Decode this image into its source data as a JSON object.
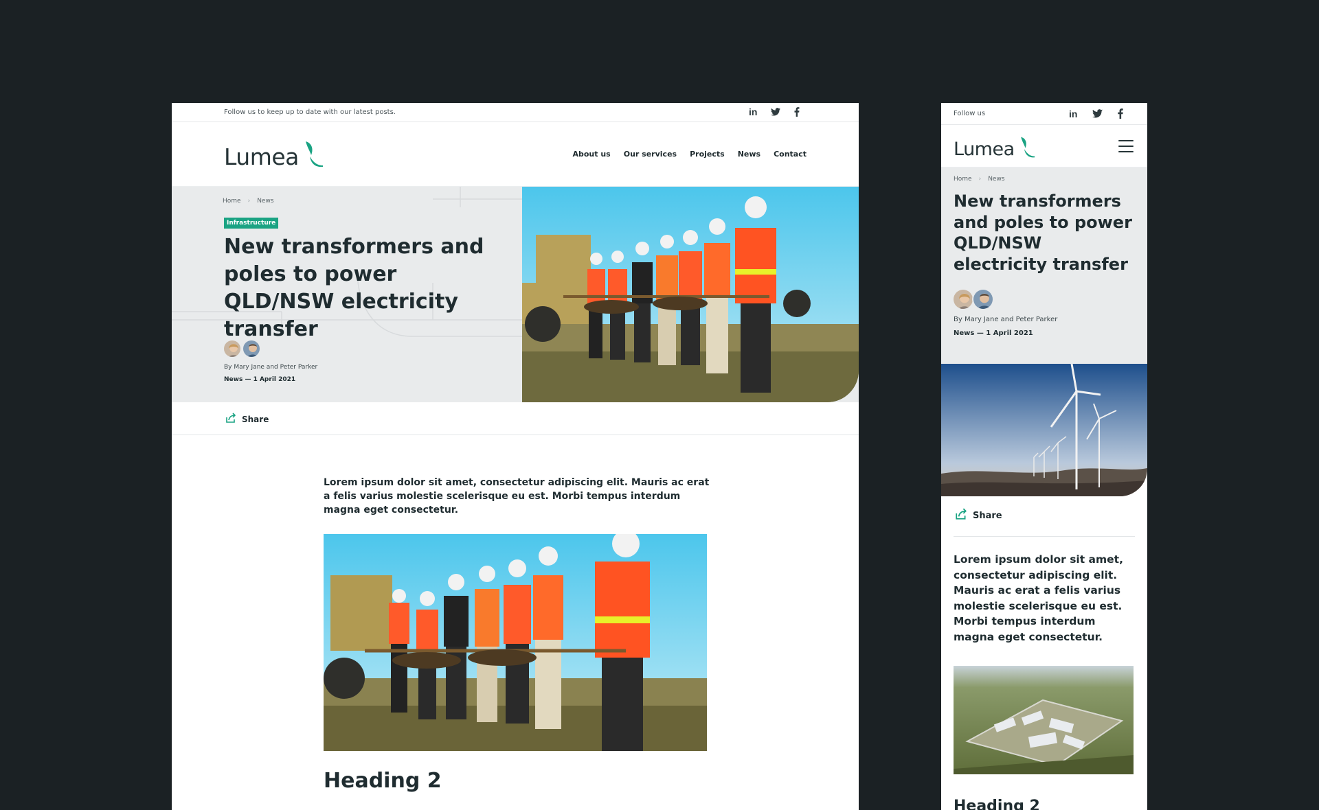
{
  "desktop": {
    "topbar": {
      "follow_text": "Follow us to keep up to date with our latest posts."
    },
    "social": {
      "linkedin": "in"
    },
    "logo": {
      "text": "Lumea"
    },
    "nav": [
      "About us",
      "Our services",
      "Projects",
      "News",
      "Contact"
    ],
    "breadcrumb": {
      "home": "Home",
      "current": "News",
      "separator": "›"
    },
    "tag": "Infrastructure",
    "title": "New transformers and poles to power QLD/NSW electricity transfer",
    "byline": "By Mary Jane and Peter Parker",
    "meta": "News — 1 April 2021",
    "share_label": "Share",
    "intro": "Lorem ipsum dolor sit amet, consectetur adipiscing elit. Mauris ac erat a felis varius molestie scelerisque eu est. Morbi tempus interdum magna eget consectetur.",
    "heading2": "Heading 2"
  },
  "mobile": {
    "topbar": {
      "follow_text": "Follow us"
    },
    "social": {
      "linkedin": "in"
    },
    "logo": {
      "text": "Lumea"
    },
    "breadcrumb": {
      "home": "Home",
      "current": "News",
      "separator": "›"
    },
    "title": "New transformers and poles to power QLD/NSW electricity transfer",
    "byline": "By Mary Jane and Peter Parker",
    "meta": "News — 1 April 2021",
    "share_label": "Share",
    "intro": "Lorem ipsum dolor sit amet, consectetur adipiscing elit. Mauris ac erat a felis varius molestie scelerisque eu est. Morbi tempus interdum magna eget consectetur.",
    "heading2": "Heading 2"
  },
  "colors": {
    "background": "#1b2124",
    "accent": "#1aa383",
    "text_dark": "#1f2c30",
    "hero_grey": "#e9ebec"
  },
  "icons": [
    "linkedin-icon",
    "twitter-icon",
    "facebook-icon",
    "logo-leaf-icon",
    "share-icon",
    "hamburger-menu-icon",
    "breadcrumb-chevron-icon"
  ]
}
